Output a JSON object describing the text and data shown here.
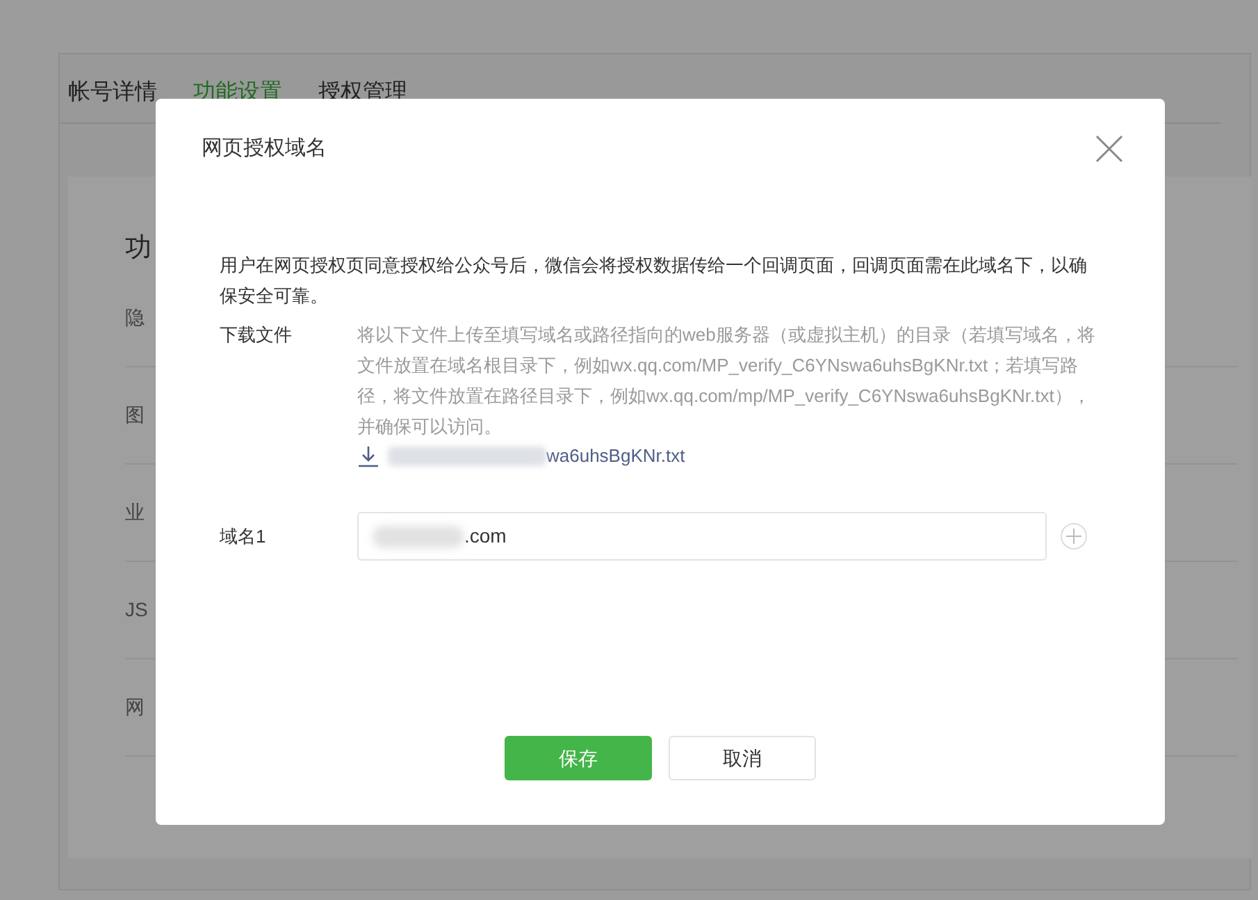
{
  "tabs": [
    {
      "label": "帐号详情",
      "selected": false
    },
    {
      "label": "功能设置",
      "selected": true
    },
    {
      "label": "授权管理",
      "selected": false
    }
  ],
  "section_title": "功",
  "settings_rows": [
    "隐",
    "图",
    "业",
    "JS",
    "网"
  ],
  "dialog": {
    "title": "网页授权域名",
    "description": "用户在网页授权页同意授权给公众号后，微信会将授权数据传给一个回调页面，回调页面需在此域名下，以确保安全可靠。",
    "download_label": "下载文件",
    "download_help": "将以下文件上传至填写域名或路径指向的web服务器（或虚拟主机）的目录（若填写域名，将文件放置在域名根目录下，例如wx.qq.com/MP_verify_C6YNswa6uhsBgKNr.txt；若填写路径，将文件放置在路径目录下，例如wx.qq.com/mp/MP_verify_C6YNswa6uhsBgKNr.txt），并确保可以访问。",
    "download_link": "wa6uhsBgKNr.txt",
    "domain_label": "域名1",
    "domain_value": ".com",
    "buttons": [
      {
        "label": "保存",
        "kind": "primary"
      },
      {
        "label": "取消",
        "kind": "secondary"
      }
    ]
  }
}
